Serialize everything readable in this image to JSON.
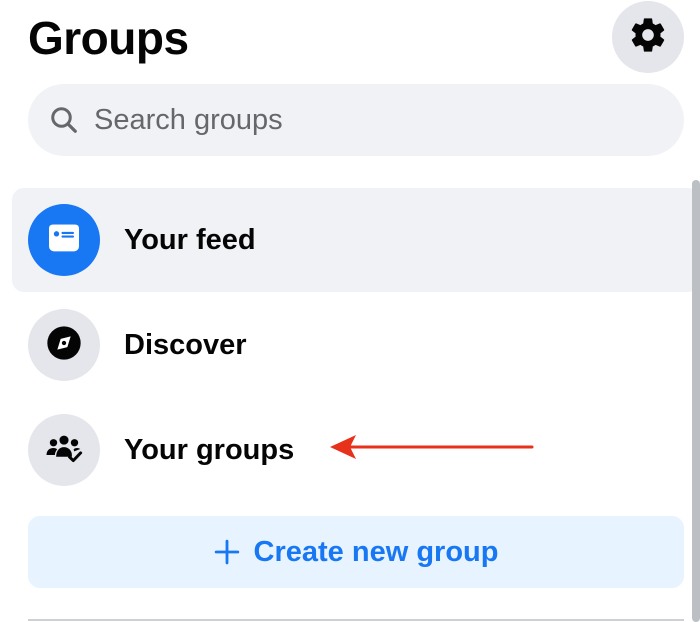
{
  "header": {
    "title": "Groups",
    "settings_icon": "gear-icon"
  },
  "search": {
    "placeholder": "Search groups",
    "value": "",
    "icon": "search-icon"
  },
  "nav": {
    "items": [
      {
        "label": "Your feed",
        "icon": "feed-icon",
        "active": true
      },
      {
        "label": "Discover",
        "icon": "compass-icon",
        "active": false
      },
      {
        "label": "Your groups",
        "icon": "groups-icon",
        "active": false
      }
    ]
  },
  "create": {
    "label": "Create new group",
    "icon": "plus-icon"
  },
  "annotation": {
    "arrow_color": "#e8311a"
  },
  "colors": {
    "accent": "#1877f2",
    "accent_light": "#e7f3ff",
    "surface": "#f0f2f5",
    "icon_bg": "#e4e6eb",
    "text": "#050505",
    "muted": "#65676b"
  }
}
